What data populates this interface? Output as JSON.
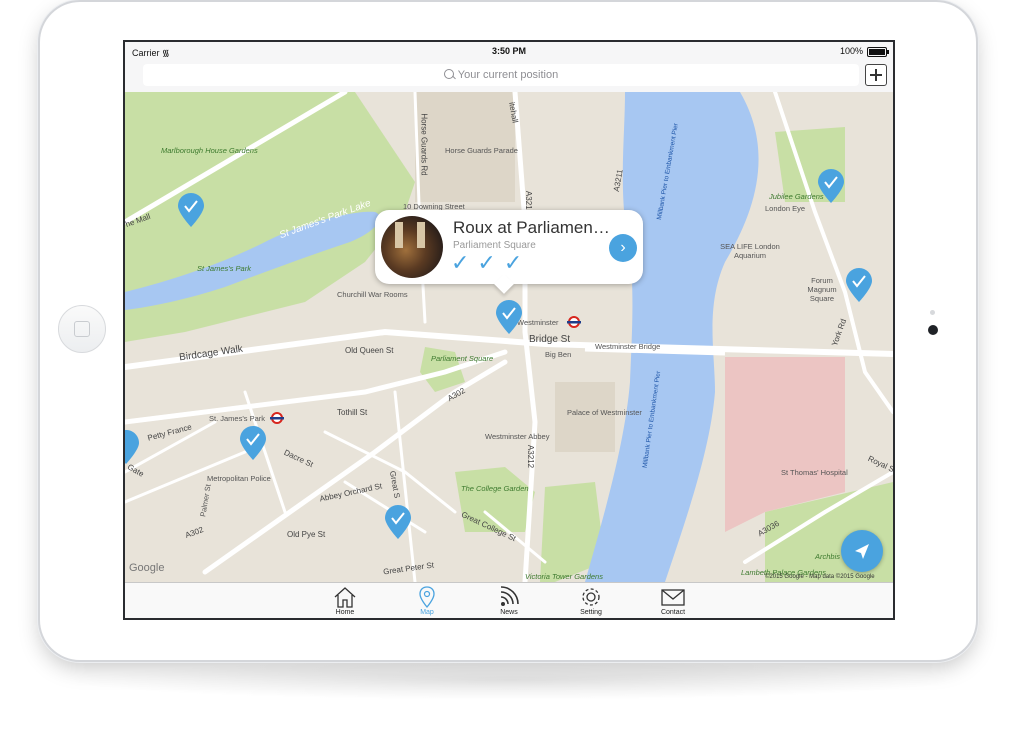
{
  "status_bar": {
    "carrier": "Carrier",
    "time": "3:50 PM",
    "battery": "100%"
  },
  "search": {
    "placeholder": "Your current position"
  },
  "callout": {
    "title": "Roux at Parliamen…",
    "subtitle": "Parliament Square",
    "checks": "✓✓✓",
    "go": "›"
  },
  "map": {
    "labels": {
      "marlborough": "Marlborough House Gardens",
      "the_mall": "he Mall",
      "st_james_park_lake": "St James's Park Lake",
      "st_james_park": "St James's Park",
      "horse_guards_rd": "Horse Guards Rd",
      "horse_guards_parade": "Horse Guards Parade",
      "downing": "10 Downing Street",
      "whitehall": "itehall",
      "a3212_top": "A3212",
      "a3211": "A3211",
      "churchill": "Churchill War Rooms",
      "westminster": "Westminster",
      "bridge_st": "Bridge St",
      "big_ben": "Big Ben",
      "westminster_bridge": "Westminster Bridge",
      "parliament_square": "Parliament Square",
      "birdcage": "Birdcage Walk",
      "old_queen": "Old Queen St",
      "tothill": "Tothill St",
      "a302_mid": "A302",
      "st_james_station": "St. James's Park",
      "petty_france": "Petty France",
      "dacre": "Dacre St",
      "palace": "Palace of Westminster",
      "abbey": "Westminster Abbey",
      "a3212_mid": "A3212",
      "metropolitan": "Metropolitan Police",
      "abbey_orchard": "Abbey Orchard St",
      "college_garden": "The College Garden",
      "great_college": "Great College St",
      "old_pye": "Old Pye St",
      "a302_low": "A302",
      "great_peter": "Great Peter St",
      "great_smith": "Great S",
      "victoria_tower": "Victoria Tower Gardens",
      "palmer": "Palmer St",
      "gate": "Gate",
      "jubilee": "Jubilee Gardens",
      "london_eye": "London Eye",
      "sea_life": "SEA LIFE London Aquarium",
      "forum": "Forum Magnum Square",
      "york_rd": "York Rd",
      "millbank_top": "Millbank Pier to Embankment Pier",
      "millbank_low": "Millbank Pier to Embankment Pier",
      "st_thomas": "St Thomas' Hospital",
      "royal_st": "Royal St",
      "a3036": "A3036",
      "archbishop": "Archbis",
      "lambeth": "Lambeth Palace Gardens",
      "google": "Google",
      "copyright": "©2015 Google - Map data ©2015 Google"
    }
  },
  "tabs": [
    {
      "label": "Home",
      "icon": "home-icon"
    },
    {
      "label": "Map",
      "icon": "map-pin-icon"
    },
    {
      "label": "News",
      "icon": "rss-icon"
    },
    {
      "label": "Setting",
      "icon": "gear-icon"
    },
    {
      "label": "Contact",
      "icon": "mail-icon"
    }
  ],
  "colors": {
    "accent": "#4aa3df",
    "water": "#a7c7f2",
    "park": "#c8dfa5",
    "road": "#ffffff"
  }
}
